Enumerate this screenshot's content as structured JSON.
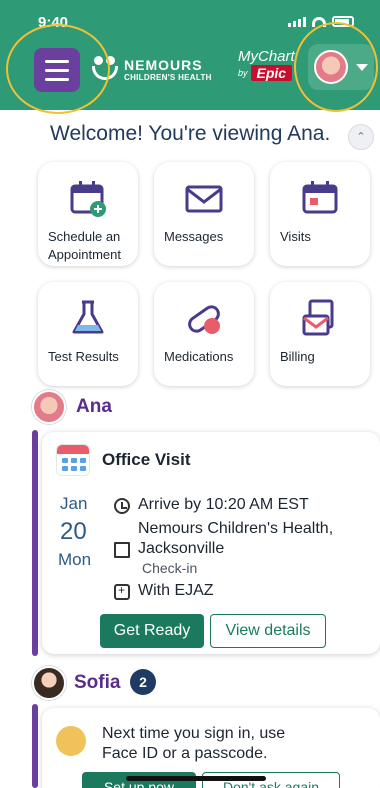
{
  "status_bar": {
    "time": "9:40"
  },
  "header": {
    "brand_name": "NEMOURS",
    "brand_sub": "CHILDREN'S HEALTH",
    "mychart_label": "MyChart",
    "mychart_by": "by",
    "mychart_vendor": "Epic"
  },
  "welcome": {
    "text": "Welcome! You're viewing Ana."
  },
  "tiles": [
    {
      "label": "Schedule an Appointment",
      "icon": "calendar-add-icon"
    },
    {
      "label": "Messages",
      "icon": "envelope-icon"
    },
    {
      "label": "Visits",
      "icon": "calendar-icon"
    },
    {
      "label": "Test Results",
      "icon": "flask-icon"
    },
    {
      "label": "Medications",
      "icon": "pill-icon"
    },
    {
      "label": "Billing",
      "icon": "billing-icon"
    }
  ],
  "patients": [
    {
      "name": "Ana"
    },
    {
      "name": "Sofia",
      "badge": "2"
    }
  ],
  "appointment": {
    "title": "Office Visit",
    "month": "Jan",
    "day": "20",
    "weekday": "Mon",
    "arrive": "Arrive by 10:20 AM EST",
    "location_line1": "Nemours Children's Health,",
    "location_line2": "Jacksonville",
    "checkin": "Check-in",
    "provider": "With EJAZ",
    "primary_button": "Get Ready",
    "secondary_button": "View details"
  },
  "face_id": {
    "text_line1": "Next time you sign in, use",
    "text_line2": "Face ID or a passcode.",
    "setup_button": "Set up now",
    "dont_button": "Don't ask again"
  },
  "colors": {
    "header": "#2f9a76",
    "menu": "#6a3f9e",
    "primary": "#1b7a5e",
    "patient_name": "#5a2d8a",
    "highlight_ring": "#f0c035"
  }
}
